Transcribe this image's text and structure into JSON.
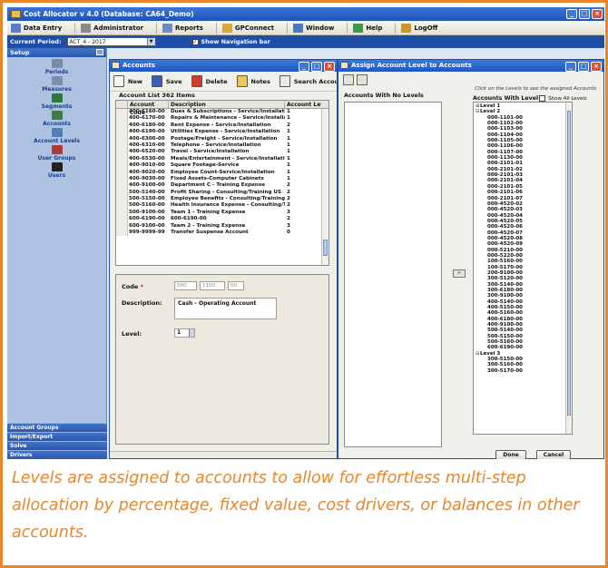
{
  "app": {
    "title": "Cost Allocator v 4.0  (Database: CA64_Demo)",
    "menu": [
      {
        "label": "Data Entry",
        "icon": "data-entry-icon",
        "color": "#5a7cc8"
      },
      {
        "label": "Administrator",
        "icon": "administrator-icon",
        "color": "#888888"
      },
      {
        "label": "Reports",
        "icon": "reports-icon",
        "color": "#6b8bc9"
      },
      {
        "label": "GPConnect",
        "icon": "gpconnect-icon",
        "color": "#d8a93a"
      },
      {
        "label": "Window",
        "icon": "window-icon",
        "color": "#4c79c3"
      },
      {
        "label": "Help",
        "icon": "help-icon",
        "color": "#3b9a45"
      },
      {
        "label": "LogOff",
        "icon": "logoff-icon",
        "color": "#c9962c"
      }
    ],
    "period_label": "Current Period:",
    "period_value": "ACT_4            - 2017",
    "nav_check_label": "Show Navigation bar",
    "nav_check_mark": "✓"
  },
  "sidebar": {
    "header": "Setup",
    "items": [
      {
        "label": "Periods",
        "icon": "periods-icon",
        "color": "#7a8aa8"
      },
      {
        "label": "Measures",
        "icon": "measures-icon",
        "color": "#7b8fa8"
      },
      {
        "label": "Segments",
        "icon": "segments-icon",
        "color": "#2b7a3a"
      },
      {
        "label": "Accounts",
        "icon": "accounts-icon",
        "color": "#3d7d4a"
      },
      {
        "label": "Account Levels",
        "icon": "account-levels-icon",
        "color": "#4f7eb8"
      },
      {
        "label": "User Groups",
        "icon": "user-groups-icon",
        "color": "#b03a3a"
      },
      {
        "label": "Users",
        "icon": "users-icon",
        "color": "#222222"
      }
    ],
    "bottom": [
      "Account Groups",
      "Import/Export",
      "Solve",
      "Drivers"
    ]
  },
  "accounts_window": {
    "title": "Accounts",
    "toolbar": [
      {
        "label": "New",
        "icon": "new-icon",
        "color": "#f4f4f4"
      },
      {
        "label": "Save",
        "icon": "save-icon",
        "color": "#3b5fb2"
      },
      {
        "label": "Delete",
        "icon": "delete-icon",
        "color": "#d23a2a"
      },
      {
        "label": "Notes",
        "icon": "notes-icon",
        "color": "#e8c95a"
      },
      {
        "label": "Search Accounts",
        "icon": "search-icon",
        "color": "#e9e9e9"
      }
    ],
    "list_caption": "Account List     362 Items",
    "columns": [
      "Account Code",
      "Description",
      "Account Level"
    ],
    "rows": [
      [
        "400-6160-00",
        "Dues & Subscriptions - Service/Installati",
        "1"
      ],
      [
        "400-6170-00",
        "Repairs & Maintenance - Service/Installa",
        "1"
      ],
      [
        "400-6180-00",
        "Rent Expense - Service/Installation",
        "2"
      ],
      [
        "400-6190-00",
        "Utilities Expense - Service/Installation",
        "1"
      ],
      [
        "400-6300-00",
        "Postage/Freight - Service/Installation",
        "1"
      ],
      [
        "400-6310-00",
        "Telephone - Service/Installation",
        "1"
      ],
      [
        "400-6520-00",
        "Travel - Service/Installation",
        "1"
      ],
      [
        "400-6530-00",
        "Meals/Entertainment - Service/Installati",
        "1"
      ],
      [
        "400-9010-00",
        "Square Footage-Service",
        "1"
      ],
      [
        "400-9020-00",
        "Employee Count-Service/Installation",
        "1"
      ],
      [
        "400-9030-00",
        "Fixed Assets-Computer Cabinets",
        "1"
      ],
      [
        "400-9100-00",
        "Department C - Training Expense",
        "2"
      ],
      [
        "500-5140-00",
        "Profit Sharing - Consulting/Training US",
        "2"
      ],
      [
        "500-5150-00",
        "Employee Benefits - Consulting/Training",
        "2"
      ],
      [
        "500-5160-00",
        "Health Insurance Expense - Consulting/T",
        "2"
      ],
      [
        "500-9100-00",
        "Team 1 - Training Expense",
        "3"
      ],
      [
        "600-6190-00",
        "600-6190-00",
        "2"
      ],
      [
        "600-9100-00",
        "Team 2 - Training Expense",
        "3"
      ],
      [
        "999-9999-99",
        "Transfer Suspense Account",
        "0"
      ]
    ],
    "code_label": "Code",
    "required_mark": "*",
    "code_parts": [
      "000",
      "1100",
      "00"
    ],
    "description_label": "Description:",
    "description_value": "Cash - Operating Account",
    "level_label": "Level:",
    "level_value": "1"
  },
  "assign_window": {
    "title": "Assign Account Level to Accounts",
    "hint": "Click on the Levels to see the assigned Accounts",
    "left_header": "Accounts With No Levels",
    "right_header": "Accounts With Level",
    "show_all": "Show All Levels",
    "move_label": ">",
    "tree": [
      {
        "type": "level",
        "label": "Level 1",
        "exp": "⊞"
      },
      {
        "type": "level",
        "label": "Level 2",
        "exp": "⊟"
      },
      {
        "type": "acct",
        "label": "000-1101-00"
      },
      {
        "type": "acct",
        "label": "000-1102-00"
      },
      {
        "type": "acct",
        "label": "000-1103-00"
      },
      {
        "type": "acct",
        "label": "000-1104-00"
      },
      {
        "type": "acct",
        "label": "000-1105-00"
      },
      {
        "type": "acct",
        "label": "000-1106-00"
      },
      {
        "type": "acct",
        "label": "000-1107-00"
      },
      {
        "type": "acct",
        "label": "000-1130-00"
      },
      {
        "type": "acct",
        "label": "000-2101-01"
      },
      {
        "type": "acct",
        "label": "000-2101-02"
      },
      {
        "type": "acct",
        "label": "000-2101-03"
      },
      {
        "type": "acct",
        "label": "000-2101-04"
      },
      {
        "type": "acct",
        "label": "000-2101-05"
      },
      {
        "type": "acct",
        "label": "000-2101-06"
      },
      {
        "type": "acct",
        "label": "000-2101-07"
      },
      {
        "type": "acct",
        "label": "000-4520-02"
      },
      {
        "type": "acct",
        "label": "000-4520-03"
      },
      {
        "type": "acct",
        "label": "000-4520-04"
      },
      {
        "type": "acct",
        "label": "000-4520-05"
      },
      {
        "type": "acct",
        "label": "000-4520-06"
      },
      {
        "type": "acct",
        "label": "000-4520-07"
      },
      {
        "type": "acct",
        "label": "000-4520-08"
      },
      {
        "type": "acct",
        "label": "000-4520-09"
      },
      {
        "type": "acct",
        "label": "000-5210-00"
      },
      {
        "type": "acct",
        "label": "000-5220-00"
      },
      {
        "type": "acct",
        "label": "100-5160-00"
      },
      {
        "type": "acct",
        "label": "100-5170-00"
      },
      {
        "type": "acct",
        "label": "200-9100-00"
      },
      {
        "type": "acct",
        "label": "300-5120-00"
      },
      {
        "type": "acct",
        "label": "300-5140-00"
      },
      {
        "type": "acct",
        "label": "300-6180-00"
      },
      {
        "type": "acct",
        "label": "300-9100-00"
      },
      {
        "type": "acct",
        "label": "400-5140-00"
      },
      {
        "type": "acct",
        "label": "400-5150-00"
      },
      {
        "type": "acct",
        "label": "400-5160-00"
      },
      {
        "type": "acct",
        "label": "400-6180-00"
      },
      {
        "type": "acct",
        "label": "400-9100-00"
      },
      {
        "type": "acct",
        "label": "500-5140-00"
      },
      {
        "type": "acct",
        "label": "500-5150-00"
      },
      {
        "type": "acct",
        "label": "500-5160-00"
      },
      {
        "type": "acct",
        "label": "600-6190-00"
      },
      {
        "type": "level",
        "label": "Level 3",
        "exp": "⊟"
      },
      {
        "type": "acct",
        "label": "300-5150-00"
      },
      {
        "type": "acct",
        "label": "300-5160-00"
      },
      {
        "type": "acct",
        "label": "300-5170-00"
      }
    ],
    "done_label": "Done",
    "cancel_label": "Cancel"
  },
  "caption": "Levels are assigned to accounts to allow for effortless multi-step allocation by percentage, fixed value, cost drivers, or balances in other accounts.",
  "colors": {
    "accent": "#e8862a",
    "titlebar": "#2257bd",
    "sidebar": "#aec2e2"
  }
}
